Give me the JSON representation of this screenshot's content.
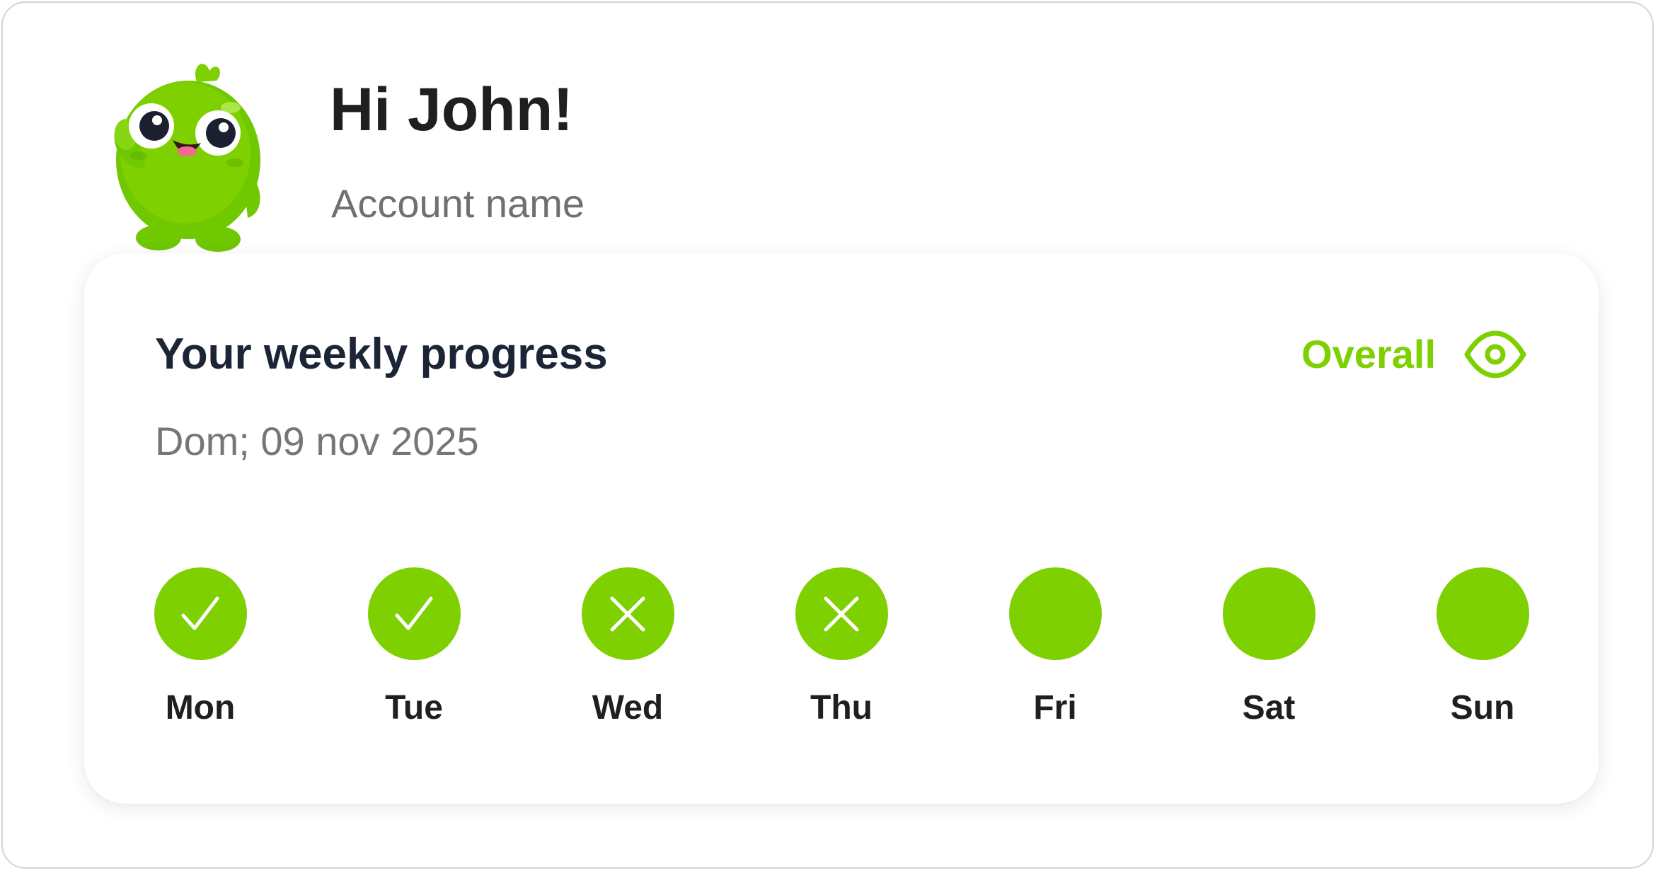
{
  "header": {
    "greeting": "Hi John!",
    "account_name": "Account name"
  },
  "mascot": {
    "icon": "green-bird-mascot-icon"
  },
  "progress_card": {
    "title": "Your weekly progress",
    "date": "Dom; 09 nov 2025",
    "overall_label": "Overall",
    "overall_icon": "eye-icon",
    "accent_color": "#7ed000",
    "days": [
      {
        "label": "Mon",
        "status": "done"
      },
      {
        "label": "Tue",
        "status": "done"
      },
      {
        "label": "Wed",
        "status": "missed"
      },
      {
        "label": "Thu",
        "status": "missed"
      },
      {
        "label": "Fri",
        "status": "pending"
      },
      {
        "label": "Sat",
        "status": "pending"
      },
      {
        "label": "Sun",
        "status": "pending"
      }
    ]
  }
}
